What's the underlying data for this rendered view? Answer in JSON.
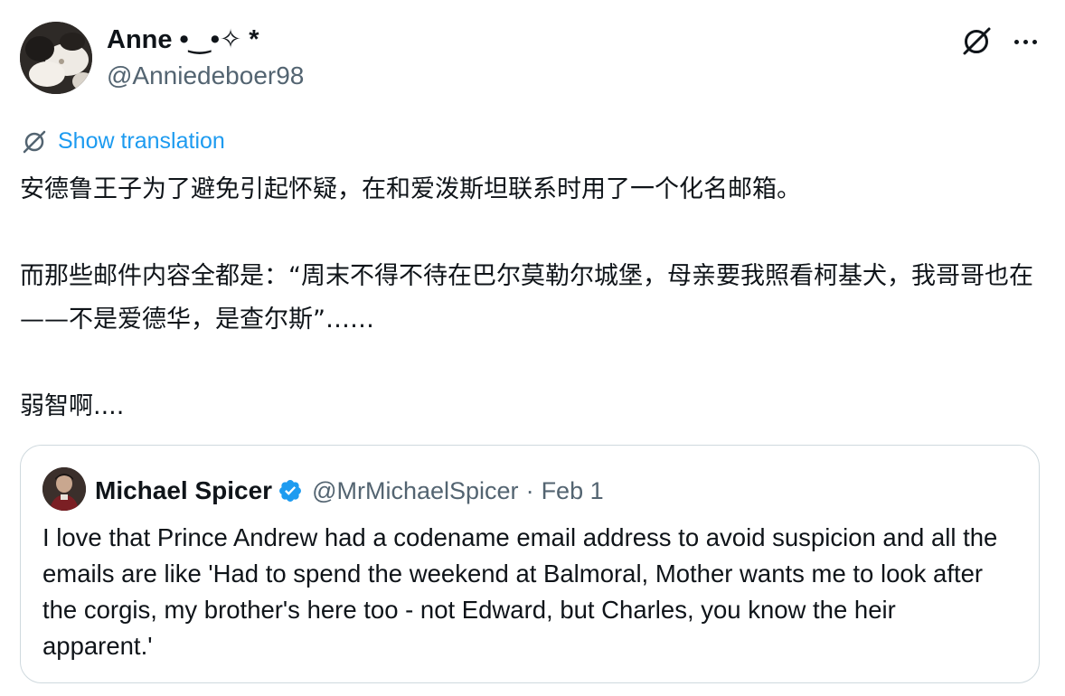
{
  "tweet": {
    "author": {
      "name": "Anne •‿•✧ *",
      "handle": "@Anniedeboer98"
    },
    "grok_icon": "grok-slash-circle-icon",
    "more_icon": "more-horizontal-icon",
    "translate_label": "Show translation",
    "paragraphs": [
      "安德鲁王子为了避免引起怀疑，在和爱泼斯坦联系时用了一个化名邮箱。",
      "而那些邮件内容全都是：“周末不得不待在巴尔莫勒尔城堡，母亲要我照看柯基犬，我哥哥也在——不是爱德华，是查尔斯”……",
      "弱智啊...."
    ]
  },
  "quote": {
    "name": "Michael Spicer",
    "handle": "@MrMichaelSpicer",
    "separator": "·",
    "date": "Feb 1",
    "verified_icon": "verified-badge-icon",
    "text": "I love that Prince Andrew had a codename email address to avoid suspicion and all the emails are like 'Had to spend the weekend at Balmoral, Mother wants me to look after the corgis, my brother's here too - not Edward, but Charles, you know the heir apparent.'"
  },
  "colors": {
    "link": "#1d9bf0",
    "secondary_text": "#536471",
    "border": "#cfd9de",
    "verified": "#1d9bf0"
  }
}
